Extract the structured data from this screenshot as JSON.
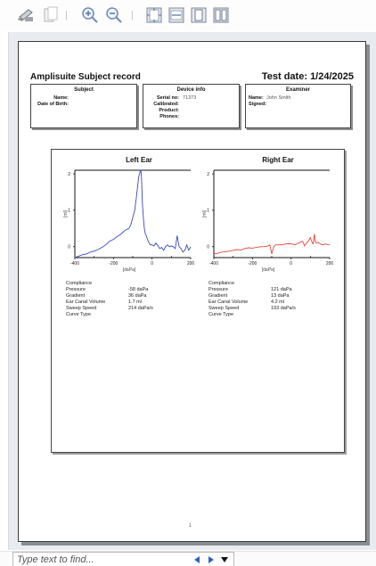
{
  "toolbar": {
    "icons": [
      "print-icon",
      "page-setup-icon",
      "zoom-in-icon",
      "zoom-out-icon",
      "fit-page-icon",
      "fit-width-icon",
      "single-page-icon",
      "two-pages-icon"
    ]
  },
  "report": {
    "title": "Amplisuite Subject record",
    "date_label": "Test date:",
    "date_value": "1/24/2025",
    "subject": {
      "heading": "Subject",
      "name_label": "Name:",
      "name_value": "",
      "dob_label": "Date of Birth:",
      "dob_value": ""
    },
    "device": {
      "heading": "Device info",
      "serial_label": "Serial no:",
      "serial_value": "71373",
      "calibrated_label": "Calibrated:",
      "calibrated_value": "",
      "product_label": "Product:",
      "product_value": "",
      "phones_label": "Phones:",
      "phones_value": ""
    },
    "examiner": {
      "heading": "Examiner",
      "name_label": "Name:",
      "name_value": "John Smith",
      "signed_label": "Signed:",
      "signed_value": ""
    },
    "page_number": "1"
  },
  "results": {
    "left": [
      {
        "label": "Compliance",
        "value": ""
      },
      {
        "label": "Pressure",
        "value": "-58 daPa"
      },
      {
        "label": "Gradient",
        "value": "36 daPa"
      },
      {
        "label": "Ear Canal Volume",
        "value": "1.7 ml"
      },
      {
        "label": "Sweep Speed",
        "value": "214 daPa/s"
      },
      {
        "label": "Curve Type",
        "value": ""
      }
    ],
    "right": [
      {
        "label": "Compliance",
        "value": ""
      },
      {
        "label": "Pressure",
        "value": "121 daPa"
      },
      {
        "label": "Gradient",
        "value": "13 daPa"
      },
      {
        "label": "Ear Canal Volume",
        "value": "4.2 ml"
      },
      {
        "label": "Sweep Speed",
        "value": "193 daPa/s"
      },
      {
        "label": "Curve Type",
        "value": ""
      }
    ]
  },
  "chart_data": [
    {
      "type": "line",
      "title": "Left Ear",
      "xlabel": "[daPa]",
      "ylabel": "[ml]",
      "xlim": [
        -400,
        200
      ],
      "ylim": [
        -0.3,
        2.1
      ],
      "xticks": [
        -400,
        -200,
        0,
        200
      ],
      "yticks": [
        0,
        1,
        2
      ],
      "color": "#3b49b8",
      "series": [
        {
          "x": [
            -400,
            -380,
            -360,
            -340,
            -320,
            -300,
            -280,
            -260,
            -240,
            -220,
            -200,
            -180,
            -160,
            -140,
            -120,
            -110,
            -100,
            -90,
            -80,
            -70,
            -65,
            -60,
            -58,
            -55,
            -50,
            -45,
            -40,
            -35,
            -30,
            -20,
            -10,
            0,
            10,
            20,
            30,
            40,
            50,
            60,
            70,
            80,
            90,
            100,
            110,
            120,
            130,
            140,
            150,
            160,
            170,
            180,
            190,
            200
          ],
          "y": [
            -0.3,
            -0.26,
            -0.22,
            -0.2,
            -0.15,
            -0.12,
            -0.08,
            -0.02,
            0.05,
            0.15,
            0.2,
            0.28,
            0.35,
            0.45,
            0.5,
            0.6,
            0.8,
            1.0,
            1.4,
            1.9,
            2.0,
            2.1,
            2.1,
            1.9,
            1.2,
            0.8,
            0.5,
            0.35,
            0.3,
            0.15,
            0.05,
            0.05,
            0.02,
            0.1,
            0.02,
            -0.05,
            -0.02,
            -0.1,
            0.0,
            0.05,
            0.0,
            0.02,
            0.0,
            -0.05,
            0.3,
            0.0,
            -0.05,
            -0.15,
            -0.1,
            0.05,
            -0.1,
            0.0
          ]
        }
      ]
    },
    {
      "type": "line",
      "title": "Right Ear",
      "xlabel": "[daPa]",
      "ylabel": "[ml]",
      "xlim": [
        -400,
        200
      ],
      "ylim": [
        -0.3,
        2.1
      ],
      "xticks": [
        -400,
        -200,
        0,
        200
      ],
      "yticks": [
        0,
        1,
        2
      ],
      "color": "#e04a3a",
      "series": [
        {
          "x": [
            -400,
            -380,
            -360,
            -340,
            -320,
            -300,
            -280,
            -260,
            -240,
            -220,
            -200,
            -180,
            -160,
            -140,
            -120,
            -110,
            -100,
            -95,
            -90,
            -80,
            -60,
            -40,
            -20,
            0,
            20,
            40,
            60,
            70,
            80,
            90,
            100,
            110,
            115,
            120,
            125,
            130,
            140,
            150,
            160,
            170,
            180,
            190,
            200
          ],
          "y": [
            -0.2,
            -0.18,
            -0.15,
            -0.14,
            -0.12,
            -0.1,
            -0.08,
            -0.09,
            -0.05,
            -0.03,
            -0.04,
            -0.02,
            0.0,
            0.0,
            0.02,
            0.05,
            -0.2,
            -0.1,
            0.0,
            0.05,
            0.05,
            0.06,
            0.08,
            0.08,
            0.05,
            0.1,
            0.15,
            0.02,
            0.1,
            0.15,
            0.25,
            0.1,
            0.08,
            0.35,
            0.15,
            0.1,
            0.12,
            0.08,
            0.05,
            0.05,
            0.08,
            0.05,
            0.05
          ]
        }
      ]
    }
  ],
  "findbar": {
    "placeholder": "Type text to find..."
  }
}
